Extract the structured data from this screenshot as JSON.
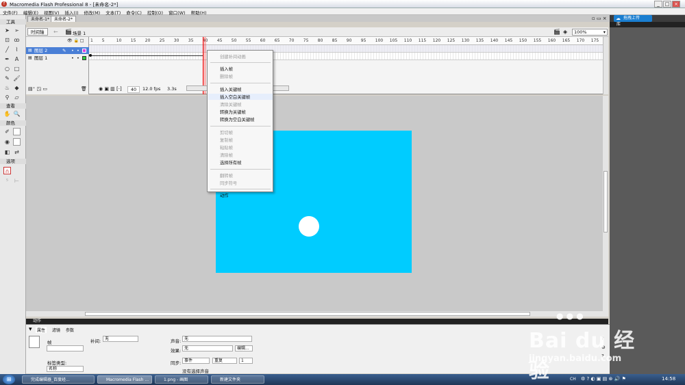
{
  "window": {
    "title": "Macromedia Flash Professional 8 - [未命名-2*]",
    "minimize": "_",
    "maximize": "□",
    "close": "×"
  },
  "menu": [
    "文件(F)",
    "编辑(E)",
    "视图(V)",
    "插入(I)",
    "修改(M)",
    "文本(T)",
    "命令(C)",
    "控制(O)",
    "窗口(W)",
    "帮助(H)"
  ],
  "tools": {
    "title": "工具",
    "view": "查看",
    "colors": "颜色",
    "options": "选项"
  },
  "doc_tabs": [
    "未命名-1*",
    "未命名-2*"
  ],
  "editbar": {
    "timeline_btn": "时间轴",
    "scene": "场景 1",
    "zoom": "100%"
  },
  "timeline": {
    "layers": [
      "图层 2",
      "图层 1"
    ],
    "ruler": [
      "1",
      "5",
      "10",
      "15",
      "20",
      "25",
      "30",
      "35",
      "40",
      "45",
      "50",
      "55",
      "60",
      "65",
      "70",
      "75",
      "80",
      "85",
      "90",
      "95",
      "100",
      "105",
      "110",
      "115",
      "120",
      "125",
      "130",
      "135",
      "140",
      "145",
      "150",
      "155",
      "160",
      "165",
      "170",
      "175"
    ],
    "frame": "40",
    "fps": "12.0 fps",
    "time": "3.3s"
  },
  "context_menu": [
    {
      "label": "创建补间动画",
      "enabled": false
    },
    {
      "sep": true
    },
    {
      "label": "插入帧",
      "enabled": true
    },
    {
      "label": "删除帧",
      "enabled": false
    },
    {
      "sep": true
    },
    {
      "label": "插入关键帧",
      "enabled": true
    },
    {
      "label": "插入空白关键帧",
      "enabled": true
    },
    {
      "label": "清除关键帧",
      "enabled": false
    },
    {
      "label": "转换为关键帧",
      "enabled": true
    },
    {
      "label": "转换为空白关键帧",
      "enabled": true
    },
    {
      "sep": true
    },
    {
      "label": "剪切帧",
      "enabled": false
    },
    {
      "label": "复制帧",
      "enabled": false
    },
    {
      "label": "粘贴帧",
      "enabled": false
    },
    {
      "label": "清除帧",
      "enabled": false
    },
    {
      "label": "选择所有帧",
      "enabled": true
    },
    {
      "sep": true
    },
    {
      "label": "翻转帧",
      "enabled": false
    },
    {
      "label": "同步符号",
      "enabled": false
    },
    {
      "sep": true
    },
    {
      "label": "动作",
      "enabled": true
    }
  ],
  "actions_bar": "动作",
  "properties": {
    "tabs": [
      "属性",
      "滤镜",
      "参数"
    ],
    "frame_label": "帧",
    "tween_label": "补间:",
    "tween_value": "无",
    "sound_label": "声音:",
    "sound_value": "无",
    "effect_label": "效果:",
    "effect_value": "无",
    "edit_btn": "编辑...",
    "label_type": "标签类型:",
    "label_type_value": "名称",
    "sync_label": "同步:",
    "sync_value": "事件",
    "repeat_value": "重复",
    "repeat_count": "1",
    "no_sound": "没有选择声音"
  },
  "right_panel": {
    "upload": "拖拽上传",
    "library": "库"
  },
  "taskbar": {
    "tasks": [
      "完成编辑器_百度经...",
      "Macromedia Flash ...",
      "1.png - 画图",
      "新建文件夹"
    ],
    "lang": "CH",
    "clock": "14:58"
  },
  "watermark": {
    "brand": "Bai du 经验",
    "url": "jingyan.baidu.com"
  },
  "colors": {
    "stage": "#00ccff",
    "circle": "#ffffff",
    "workspace": "#c9c9c9"
  }
}
